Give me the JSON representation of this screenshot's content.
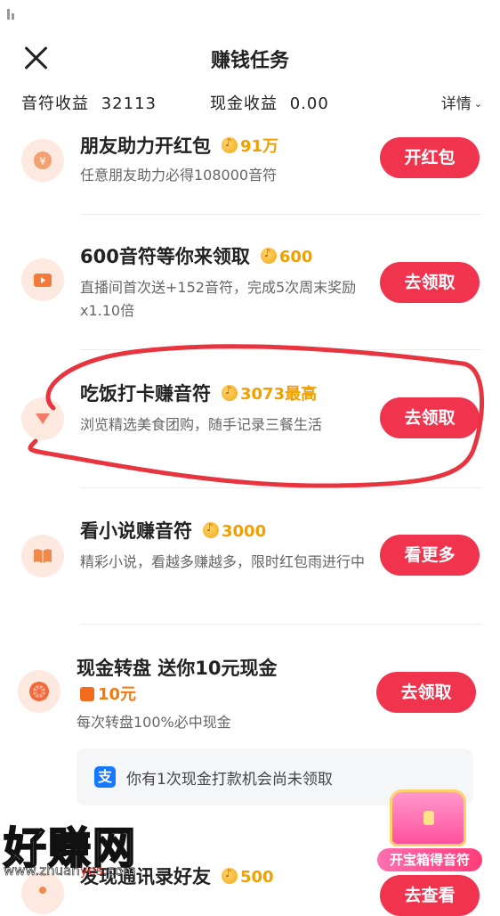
{
  "header": {
    "title": "赚钱任务",
    "close_icon": "close-icon"
  },
  "earnings": {
    "note_label": "音符收益",
    "note_value": "32113",
    "cash_label": "现金收益",
    "cash_value": "0.00",
    "details_label": "详情"
  },
  "tasks": [
    {
      "icon": "red-envelope-icon",
      "name": "朋友助力开红包",
      "reward": "91万",
      "desc": "任意朋友助力必得108000音符",
      "button": "开红包"
    },
    {
      "icon": "tv-icon",
      "name": "600音符等你来领取",
      "reward": "600",
      "desc": "直播间首次送+152音符，完成5次周末奖励x1.10倍",
      "button": "去领取"
    },
    {
      "icon": "food-icon",
      "name": "吃饭打卡赚音符",
      "reward": "3073最高",
      "desc": "浏览精选美食团购，随手记录三餐生活",
      "button": "去领取"
    },
    {
      "icon": "book-icon",
      "name": "看小说赚音符",
      "reward": "3000",
      "desc": "精彩小说，看越多赚越多，限时红包雨进行中",
      "button": "看更多"
    },
    {
      "icon": "wheel-icon",
      "name": "现金转盘 送你10元现金",
      "reward": "10元",
      "desc": "每次转盘100%必中现金",
      "button": "去领取"
    },
    {
      "icon": "contacts-icon",
      "name": "发现通讯录好友",
      "reward": "500",
      "desc": "",
      "button": "去查看"
    }
  ],
  "notice": {
    "icon": "alipay-icon",
    "text": "你有1次现金打款机会尚未领取"
  },
  "treasure": {
    "icon": "treasure-chest-icon",
    "label": "开宝箱得音符"
  },
  "watermark": {
    "text": "好赚网",
    "url_prefix": "www.zhuan",
    "url_mid": "yes",
    "url_suffix": ".com"
  },
  "colors": {
    "accent": "#f0344e",
    "reward": "#f0a000",
    "scribble": "#e8343f"
  }
}
